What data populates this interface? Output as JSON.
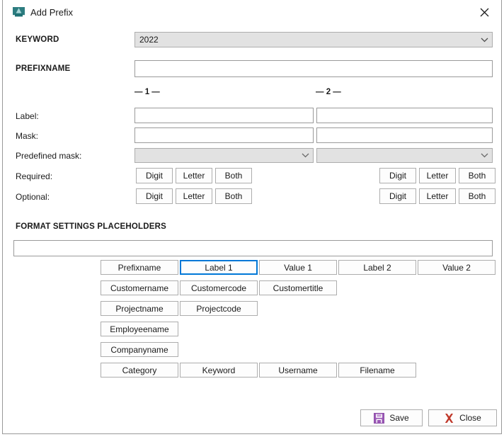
{
  "window": {
    "title": "Add Prefix",
    "app_icon": "app-logo-icon",
    "close_icon": "close-icon"
  },
  "form": {
    "keyword_header": "KEYWORD",
    "keyword_value": "2022",
    "prefixname_header": "PREFIXNAME",
    "prefixname_value": "",
    "prefixname_placeholder": "",
    "column_headers": [
      "— 1 —",
      "— 2 —"
    ],
    "rows": [
      {
        "label": "Label:",
        "type": "text"
      },
      {
        "label": "Mask:",
        "type": "text"
      },
      {
        "label": "Predefined mask:",
        "type": "combo"
      },
      {
        "label": "Required:",
        "type": "buttons"
      },
      {
        "label": "Optional:",
        "type": "buttons"
      }
    ],
    "label_values": [
      "",
      ""
    ],
    "mask_values": [
      "",
      ""
    ],
    "predefined_mask_values": [
      "",
      ""
    ],
    "char_buttons": [
      "Digit",
      "Letter",
      "Both"
    ]
  },
  "format_settings": {
    "header": "FORMAT SETTINGS  PLACEHOLDERS",
    "input_value": "",
    "rows": [
      [
        "Prefixname",
        "Label 1",
        "Value 1",
        "Label 2",
        "Value 2"
      ],
      [
        "Customername",
        "Customercode",
        "Customertitle"
      ],
      [
        "Projectname",
        "Projectcode"
      ],
      [
        "Employeename"
      ],
      [
        "Companyname"
      ],
      [
        "Category",
        "Keyword",
        "Username",
        "Filename"
      ]
    ],
    "focused_placeholder": "Label 1"
  },
  "footer": {
    "save_label": "Save",
    "save_icon": "floppy-disk-icon",
    "close_label": "Close",
    "close_icon": "red-x-icon"
  },
  "colors": {
    "accent": "#0078d7",
    "save_icon": "#8e4ea8",
    "close_icon": "#c0392b",
    "field_border": "#9a9a9a",
    "button_border": "#adadad",
    "combo_bg": "#e2e2e2"
  }
}
